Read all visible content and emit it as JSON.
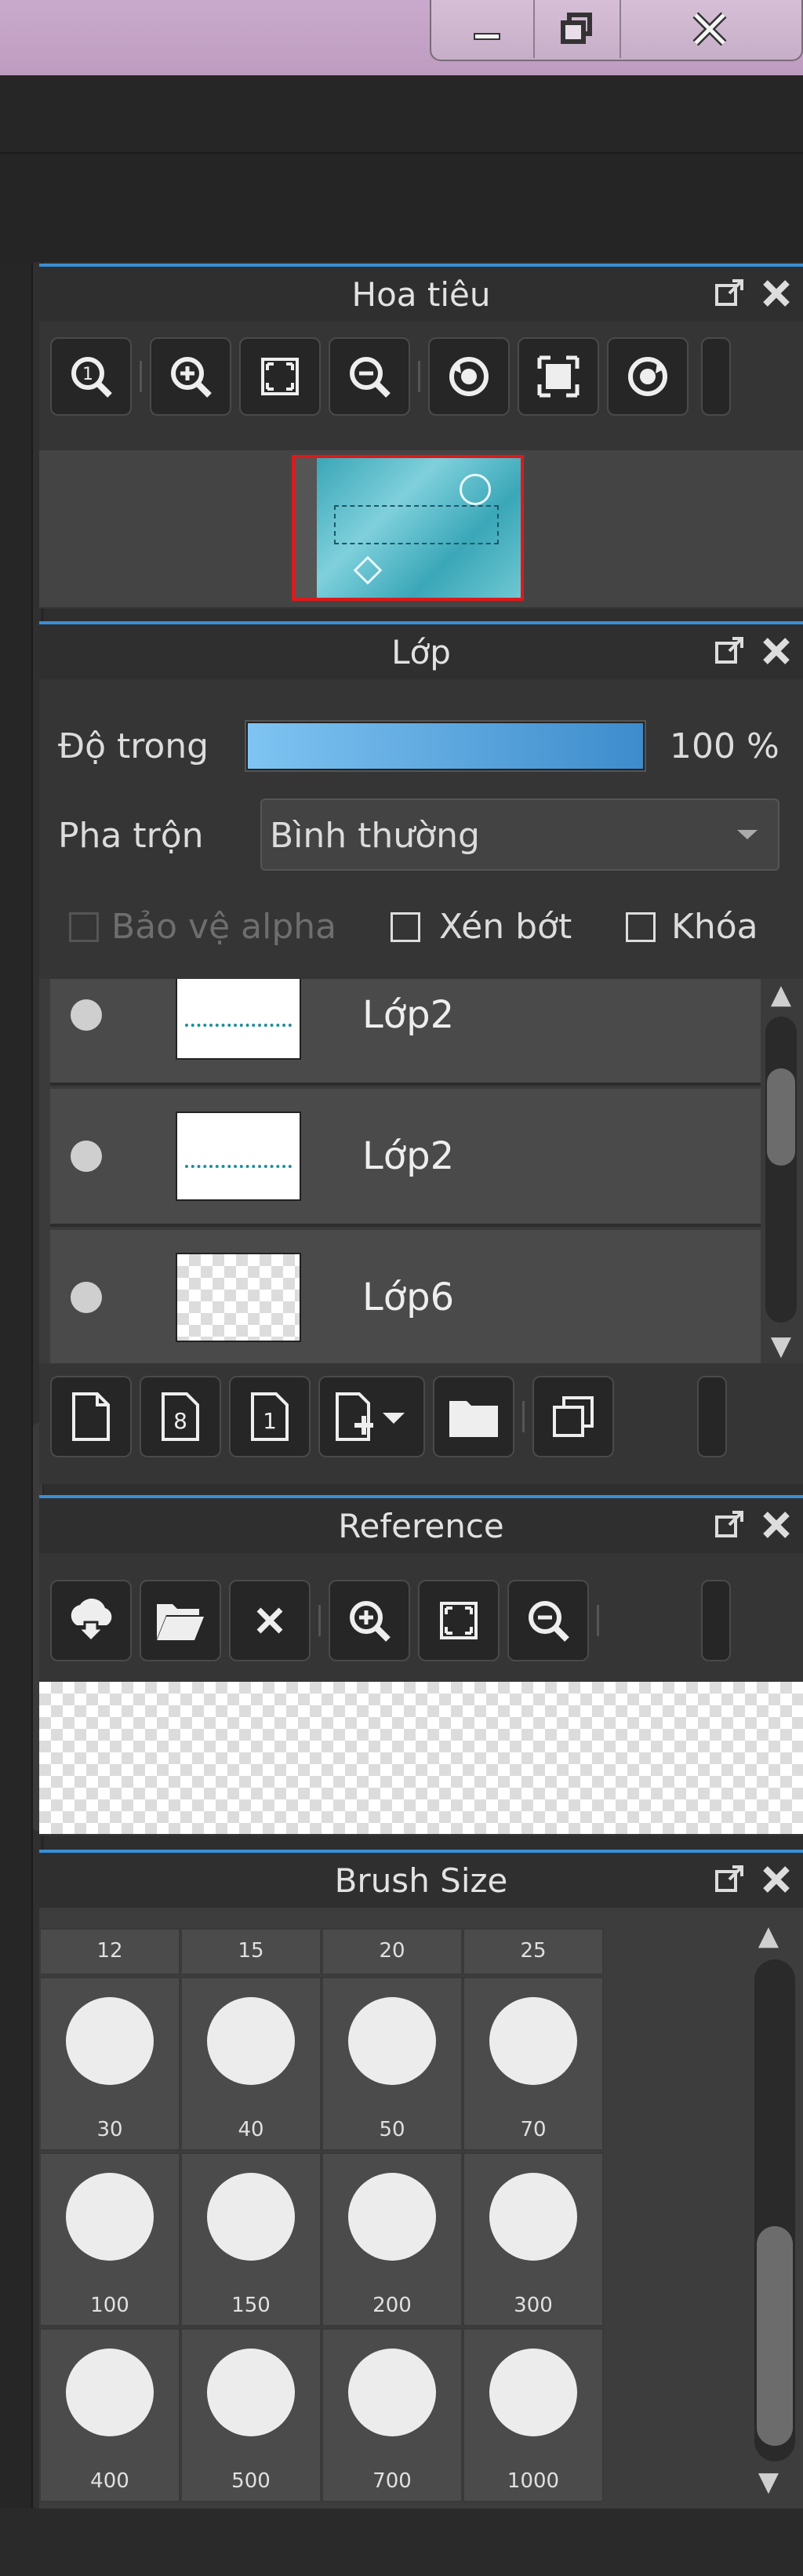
{
  "window": {
    "controls": {
      "minimize": "minimize-icon",
      "restore": "restore-icon",
      "close": "close-icon"
    },
    "colors": {
      "accent": "#3a8fd6",
      "panel_bg": "#353535",
      "header_bg": "#2f2f2f",
      "titlebar": "#c6a8c9"
    }
  },
  "navigator": {
    "title": "Hoa tiêu",
    "tools": [
      "zoom-reset-icon",
      "zoom-in-icon",
      "fit-icon",
      "zoom-out-icon",
      "rotate-left-icon",
      "fullscreen-icon",
      "rotate-right-icon"
    ]
  },
  "layers": {
    "title": "Lớp",
    "opacity_label": "Độ trong",
    "opacity_value": "100 %",
    "opacity_fraction": 1.0,
    "blend_label": "Pha trộn",
    "blend_value": "Bình thường",
    "protect_alpha": "Bảo vệ alpha",
    "clip": "Xén bớt",
    "lock": "Khóa",
    "items": [
      {
        "name": "Lớp2"
      },
      {
        "name": "Lớp2"
      },
      {
        "name": "Lớp6"
      }
    ]
  },
  "reference": {
    "title": "Reference"
  },
  "brush_size": {
    "title": "Brush Size",
    "top_row": [
      "12",
      "15",
      "20",
      "25"
    ],
    "sizes": [
      "30",
      "40",
      "50",
      "70",
      "100",
      "150",
      "200",
      "300",
      "400",
      "500",
      "700",
      "1000"
    ]
  }
}
